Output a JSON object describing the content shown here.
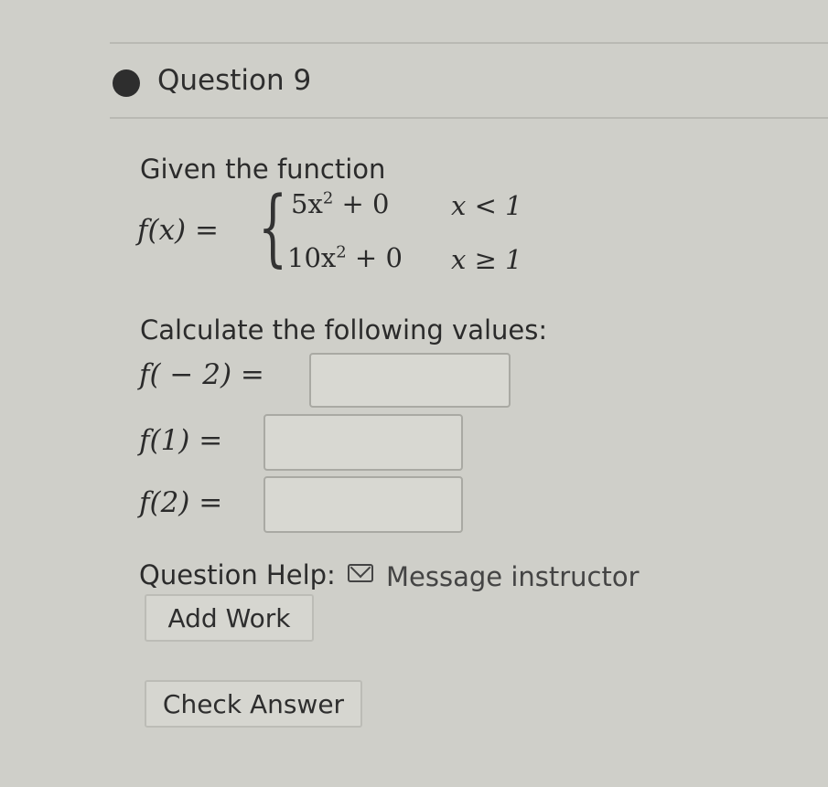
{
  "question": {
    "title": "Question 9"
  },
  "problem": {
    "intro": "Given the function",
    "fx": "f(x) =",
    "cases": [
      {
        "expr_base": "5x",
        "expr_exp": "2",
        "expr_rest": " + 0",
        "cond": "x < 1"
      },
      {
        "expr_base": "10x",
        "expr_exp": "2",
        "expr_rest": " + 0",
        "cond": "x ≥ 1"
      }
    ]
  },
  "calc": {
    "prompt": "Calculate the following values:",
    "items": [
      {
        "label": "f( − 2) =",
        "value": ""
      },
      {
        "label": "f(1) =",
        "value": ""
      },
      {
        "label": "f(2) =",
        "value": ""
      }
    ]
  },
  "help": {
    "label": "Question Help:",
    "message_link": "Message instructor",
    "add_work": "Add Work"
  },
  "check_answer": "Check Answer"
}
